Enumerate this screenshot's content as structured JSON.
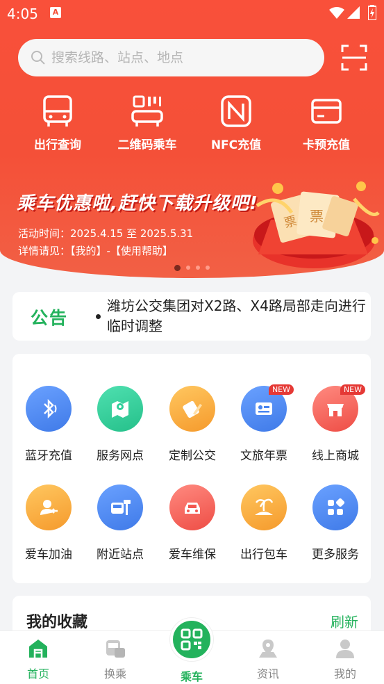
{
  "status_bar": {
    "time": "4:05",
    "notification_icon": "A"
  },
  "search": {
    "placeholder": "搜索线路、站点、地点"
  },
  "quick_actions": [
    {
      "label": "出行查询",
      "icon": "bus-icon"
    },
    {
      "label": "二维码乘车",
      "icon": "qr-bus-icon"
    },
    {
      "label": "NFC充值",
      "icon": "nfc-icon"
    },
    {
      "label": "卡预充值",
      "icon": "card-icon"
    }
  ],
  "banner": {
    "title": "乘车优惠啦,赶快下载升级吧!",
    "line1": "活动时间：2025.4.15 至 2025.5.31",
    "line2": "详情请见：【我的】-【使用帮助】",
    "ticket_text": "票",
    "pages": 4,
    "active_page": 1
  },
  "notice": {
    "tag": "公告",
    "text": "潍坊公交集团对X2路、X4路局部走向进行临时调整"
  },
  "services": [
    {
      "label": "蓝牙充值",
      "icon": "bluetooth-icon",
      "color": "#4a86f0"
    },
    {
      "label": "服务网点",
      "icon": "map-pin-icon",
      "color": "#2fcf9a"
    },
    {
      "label": "定制公交",
      "icon": "pencil-icon",
      "color": "#f7a63a"
    },
    {
      "label": "文旅年票",
      "icon": "ticket-icon",
      "color": "#4a86f0",
      "badge": "NEW"
    },
    {
      "label": "线上商城",
      "icon": "shop-icon",
      "color": "#f2574f",
      "badge": "NEW"
    },
    {
      "label": "爱车加油",
      "icon": "fuel-icon",
      "color": "#f7a63a"
    },
    {
      "label": "附近站点",
      "icon": "bus-stop-icon",
      "color": "#4a86f0"
    },
    {
      "label": "爱车维保",
      "icon": "car-icon",
      "color": "#f2574f"
    },
    {
      "label": "出行包车",
      "icon": "island-icon",
      "color": "#f7a63a"
    },
    {
      "label": "更多服务",
      "icon": "grid-icon",
      "color": "#4a86f0"
    }
  ],
  "favorites": {
    "title": "我的收藏",
    "refresh": "刷新"
  },
  "tabs": [
    {
      "label": "首页",
      "icon": "home-icon",
      "active": true
    },
    {
      "label": "换乘",
      "icon": "transfer-icon",
      "active": false
    },
    {
      "label": "乘车",
      "icon": "qr-code-icon",
      "active": false
    },
    {
      "label": "资讯",
      "icon": "news-icon",
      "active": false
    },
    {
      "label": "我的",
      "icon": "profile-icon",
      "active": false
    }
  ],
  "colors": {
    "brand_red": "#f45038",
    "brand_green": "#23b25c"
  }
}
